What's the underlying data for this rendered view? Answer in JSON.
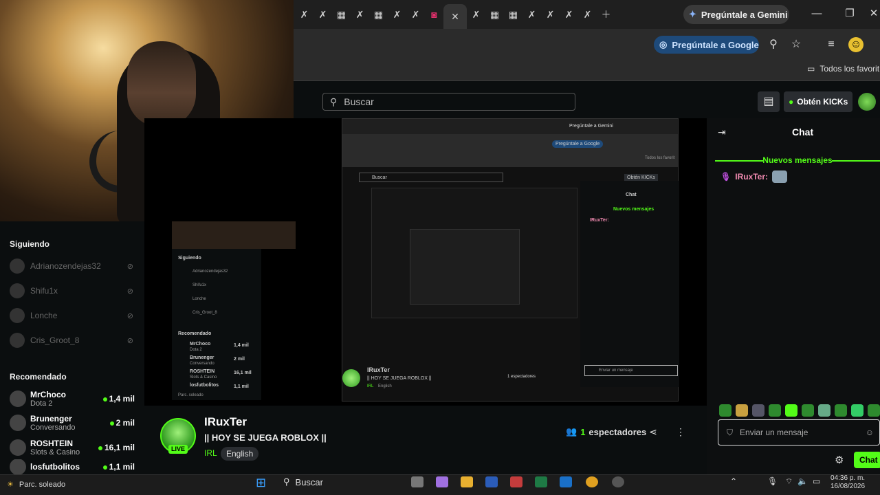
{
  "browser": {
    "gemini_label": "Pregúntale a Gemini",
    "ask_google_label": "Pregúntale a Google",
    "bookmarks_label": "Todos los favorit"
  },
  "kick": {
    "search_placeholder": "Buscar",
    "kicks_label": "Obtén KICKs"
  },
  "sidebar": {
    "following_title": "Siguiendo",
    "following": [
      {
        "name": "Adrianozendejas32"
      },
      {
        "name": "Shifu1x"
      },
      {
        "name": "Lonche"
      },
      {
        "name": "Cris_Groot_8"
      }
    ],
    "recommended_title": "Recomendado",
    "recommended": [
      {
        "name": "MrChoco",
        "category": "Dota 2",
        "viewers": "1,4 mil"
      },
      {
        "name": "Brunenger",
        "category": "Conversando",
        "viewers": "2 mil"
      },
      {
        "name": "ROSHTEIN",
        "category": "Slots & Casino",
        "viewers": "16,1 mil"
      },
      {
        "name": "losfutbolitos",
        "category": "",
        "viewers": "1,1 mil"
      }
    ]
  },
  "channel": {
    "name": "IRuxTer",
    "title": "|| HOY SE JUEGA ROBLOX ||",
    "category": "IRL",
    "language": "English",
    "live_badge": "LIVE",
    "viewers_count": "1",
    "viewers_label": "espectadores"
  },
  "chat": {
    "title": "Chat",
    "new_messages": "Nuevos mensajes",
    "message_user": "IRuxTer:",
    "input_placeholder": "Enviar un mensaje",
    "send_label": "Chat"
  },
  "nested": {
    "gemini": "Pregúntale a Gemini",
    "ask_google": "Pregúntale a Google",
    "bookmarks": "Todos los favorit",
    "search": "Buscar",
    "kicks": "Obtén KICKs",
    "chat": "Chat",
    "new_messages": "Nuevos mensajes",
    "user": "IRuxTer:",
    "following_title": "Siguiendo",
    "recommended_title": "Recomendado",
    "channel": "IRuxTer",
    "stream_title": "|| HOY SE JUEGA ROBLOX ||",
    "category": "IRL",
    "language": "English",
    "viewers": "1 espectadores",
    "input": "Enviar un mensaje",
    "weather": "Parc. soleado",
    "following": [
      "Adrianozendejas32",
      "Shifu1x",
      "Lonche",
      "Cris_Groot_8"
    ],
    "recommended": [
      {
        "name": "MrChoco",
        "category": "Dota 2",
        "viewers": "1,4 mil"
      },
      {
        "name": "Brunenger",
        "category": "Conversando",
        "viewers": "2 mil"
      },
      {
        "name": "ROSHTEIN",
        "category": "Slots & Casino",
        "viewers": "16,1 mil"
      },
      {
        "name": "losfutbolitos",
        "category": "",
        "viewers": "1,1 mil"
      }
    ]
  },
  "taskbar": {
    "weather": "Parc. soleado",
    "search_label": "Buscar",
    "time": "04:36 p. m.",
    "date": "16/08/2026"
  },
  "colors": {
    "accent": "#53fc18",
    "chat_username": "#f08ab0",
    "google_button": "#1e4a7a"
  }
}
